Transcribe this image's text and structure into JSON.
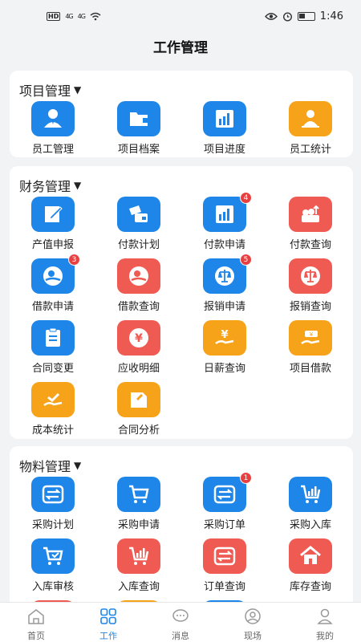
{
  "status": {
    "left_icons": [
      "hd-icon",
      "signal-4g-icon",
      "signal-4g-icon",
      "wifi-icon"
    ],
    "hd": "HD",
    "sig1": "4G",
    "sig2": "4G",
    "time": "1:46"
  },
  "header": {
    "title": "工作管理"
  },
  "sections": {
    "project": {
      "title": "项目管理",
      "items": [
        {
          "label": "员工管理",
          "icon": "employee-icon",
          "color": "#1e86e8"
        },
        {
          "label": "项目档案",
          "icon": "folder-icon",
          "color": "#1e86e8"
        },
        {
          "label": "项目进度",
          "icon": "bar-chart-icon",
          "color": "#1e86e8"
        },
        {
          "label": "员工统计",
          "icon": "person-stats-icon",
          "color": "#f6a31a"
        }
      ]
    },
    "finance": {
      "title": "财务管理",
      "items": [
        {
          "label": "产值申报",
          "icon": "edit-form-icon",
          "color": "#1e86e8"
        },
        {
          "label": "付款计划",
          "icon": "payment-card-icon",
          "color": "#1e86e8"
        },
        {
          "label": "付款申请",
          "icon": "bar-chart-icon",
          "color": "#1e86e8",
          "badge": "4"
        },
        {
          "label": "付款查询",
          "icon": "money-stack-icon",
          "color": "#ef5a52"
        },
        {
          "label": "借款申请",
          "icon": "loan-hand-icon",
          "color": "#1e86e8",
          "badge": "3"
        },
        {
          "label": "借款查询",
          "icon": "loan-hand-icon",
          "color": "#ef5a52"
        },
        {
          "label": "报销申请",
          "icon": "scale-icon",
          "color": "#1e86e8",
          "badge": "5"
        },
        {
          "label": "报销查询",
          "icon": "scale-icon",
          "color": "#ef5a52"
        },
        {
          "label": "合同变更",
          "icon": "clipboard-icon",
          "color": "#1e86e8"
        },
        {
          "label": "应收明细",
          "icon": "yen-coin-icon",
          "color": "#ef5a52"
        },
        {
          "label": "日薪查询",
          "icon": "yen-hand-icon",
          "color": "#f6a31a"
        },
        {
          "label": "项目借款",
          "icon": "money-hand-icon",
          "color": "#f6a31a"
        },
        {
          "label": "成本统计",
          "icon": "check-hand-icon",
          "color": "#f6a31a"
        },
        {
          "label": "合同分析",
          "icon": "document-icon",
          "color": "#f6a31a"
        }
      ]
    },
    "material": {
      "title": "物料管理",
      "items": [
        {
          "label": "采购计划",
          "icon": "transfer-icon",
          "color": "#1e86e8"
        },
        {
          "label": "采购申请",
          "icon": "cart-icon",
          "color": "#1e86e8"
        },
        {
          "label": "采购订单",
          "icon": "transfer-icon",
          "color": "#1e86e8",
          "badge": "1"
        },
        {
          "label": "采购入库",
          "icon": "cart-chart-icon",
          "color": "#1e86e8"
        },
        {
          "label": "入库审核",
          "icon": "cart-check-icon",
          "color": "#1e86e8"
        },
        {
          "label": "入库查询",
          "icon": "cart-chart-icon",
          "color": "#ef5a52"
        },
        {
          "label": "订单查询",
          "icon": "transfer-icon",
          "color": "#ef5a52"
        },
        {
          "label": "库存查询",
          "icon": "home-icon",
          "color": "#ef5a52"
        }
      ]
    }
  },
  "tabs": [
    {
      "label": "首页",
      "icon": "home-outline-icon"
    },
    {
      "label": "工作",
      "icon": "grid-icon",
      "active": true
    },
    {
      "label": "消息",
      "icon": "chat-icon"
    },
    {
      "label": "现场",
      "icon": "site-icon"
    },
    {
      "label": "我的",
      "icon": "user-icon"
    }
  ]
}
